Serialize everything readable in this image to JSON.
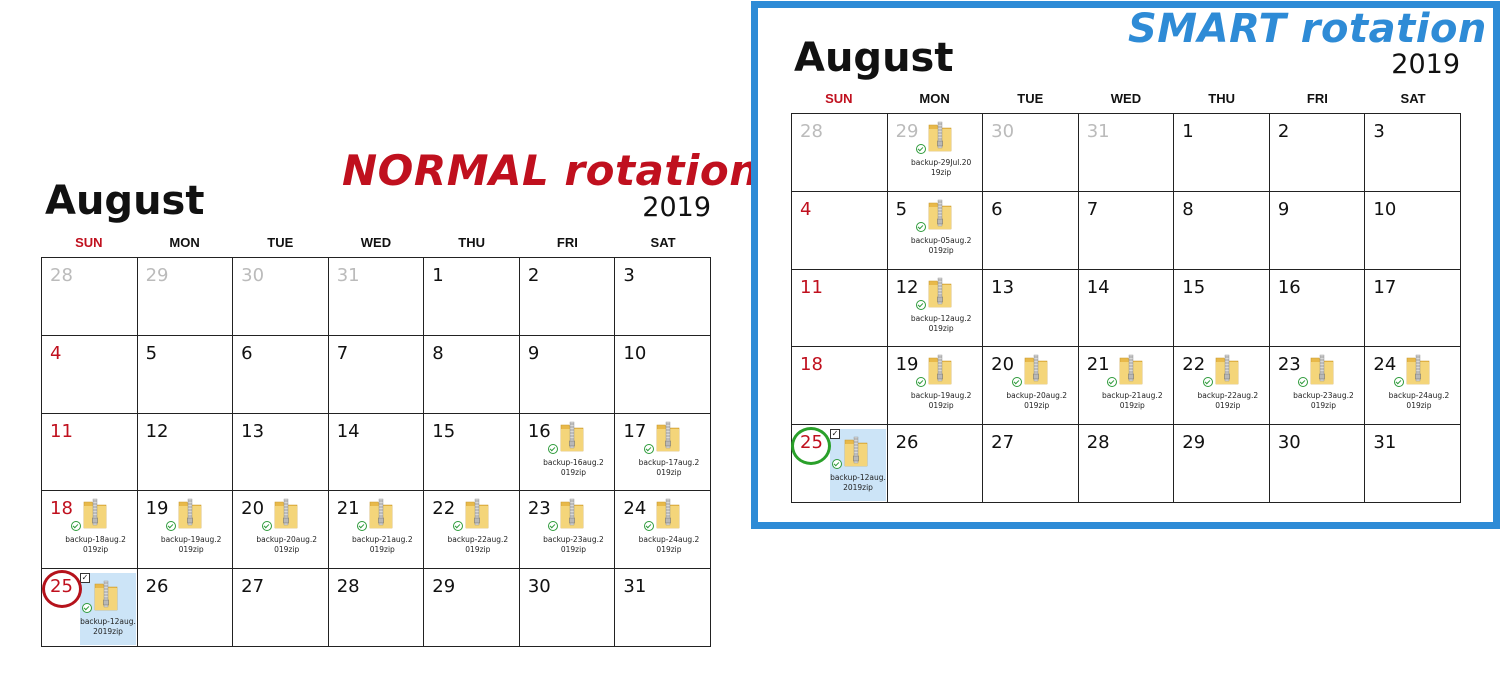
{
  "zip_icon": "zip-folder-icon",
  "colors": {
    "normal_heading": "#c0101e",
    "smart_heading": "#2e8bd6",
    "sunday": "#c0101e",
    "normal_ring": "#b5121b",
    "smart_ring": "#2aa02a",
    "selection": "#cce4f7"
  },
  "days_of_week": [
    "SUN",
    "MON",
    "TUE",
    "WED",
    "THU",
    "FRI",
    "SAT"
  ],
  "normal": {
    "heading": "NORMAL rotation",
    "month": "August",
    "year": "2019",
    "weeks": [
      [
        {
          "day": "28",
          "muted": true
        },
        {
          "day": "29",
          "muted": true
        },
        {
          "day": "30",
          "muted": true
        },
        {
          "day": "31",
          "muted": true
        },
        {
          "day": "1"
        },
        {
          "day": "2"
        },
        {
          "day": "3"
        }
      ],
      [
        {
          "day": "4"
        },
        {
          "day": "5"
        },
        {
          "day": "6"
        },
        {
          "day": "7"
        },
        {
          "day": "8"
        },
        {
          "day": "9"
        },
        {
          "day": "10"
        }
      ],
      [
        {
          "day": "11"
        },
        {
          "day": "12"
        },
        {
          "day": "13"
        },
        {
          "day": "14"
        },
        {
          "day": "15"
        },
        {
          "day": "16",
          "file": "backup-16aug.2019zip"
        },
        {
          "day": "17",
          "file": "backup-17aug.2019zip"
        }
      ],
      [
        {
          "day": "18",
          "file": "backup-18aug.2019zip"
        },
        {
          "day": "19",
          "file": "backup-19aug.2019zip"
        },
        {
          "day": "20",
          "file": "backup-20aug.2019zip"
        },
        {
          "day": "21",
          "file": "backup-21aug.2019zip"
        },
        {
          "day": "22",
          "file": "backup-22aug.2019zip"
        },
        {
          "day": "23",
          "file": "backup-23aug.2019zip"
        },
        {
          "day": "24",
          "file": "backup-24aug.2019zip"
        }
      ],
      [
        {
          "day": "25",
          "file": "backup-12aug.2019zip",
          "selected": true,
          "circled": true
        },
        {
          "day": "26"
        },
        {
          "day": "27"
        },
        {
          "day": "28"
        },
        {
          "day": "29"
        },
        {
          "day": "30"
        },
        {
          "day": "31"
        }
      ]
    ]
  },
  "smart": {
    "heading": "SMART rotation",
    "month": "August",
    "year": "2019",
    "weeks": [
      [
        {
          "day": "28",
          "muted": true
        },
        {
          "day": "29",
          "muted": true,
          "file": "backup-29Jul.2019zip"
        },
        {
          "day": "30",
          "muted": true
        },
        {
          "day": "31",
          "muted": true
        },
        {
          "day": "1"
        },
        {
          "day": "2"
        },
        {
          "day": "3"
        }
      ],
      [
        {
          "day": "4"
        },
        {
          "day": "5",
          "file": "backup-05aug.2019zip"
        },
        {
          "day": "6"
        },
        {
          "day": "7"
        },
        {
          "day": "8"
        },
        {
          "day": "9"
        },
        {
          "day": "10"
        }
      ],
      [
        {
          "day": "11"
        },
        {
          "day": "12",
          "file": "backup-12aug.2019zip"
        },
        {
          "day": "13"
        },
        {
          "day": "14"
        },
        {
          "day": "15"
        },
        {
          "day": "16"
        },
        {
          "day": "17"
        }
      ],
      [
        {
          "day": "18"
        },
        {
          "day": "19",
          "file": "backup-19aug.2019zip"
        },
        {
          "day": "20",
          "file": "backup-20aug.2019zip"
        },
        {
          "day": "21",
          "file": "backup-21aug.2019zip"
        },
        {
          "day": "22",
          "file": "backup-22aug.2019zip"
        },
        {
          "day": "23",
          "file": "backup-23aug.2019zip"
        },
        {
          "day": "24",
          "file": "backup-24aug.2019zip"
        }
      ],
      [
        {
          "day": "25",
          "file": "backup-12aug.2019zip",
          "selected": true,
          "circled": true
        },
        {
          "day": "26"
        },
        {
          "day": "27"
        },
        {
          "day": "28"
        },
        {
          "day": "29"
        },
        {
          "day": "30"
        },
        {
          "day": "31"
        }
      ]
    ]
  }
}
